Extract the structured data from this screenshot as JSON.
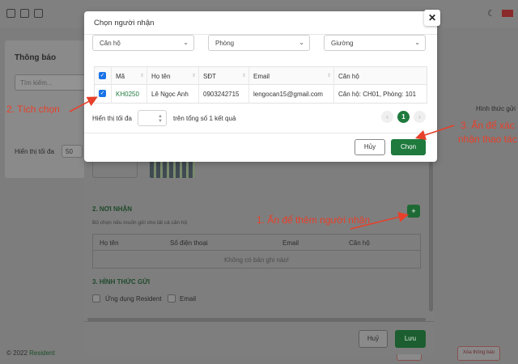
{
  "background": {
    "notifications_title": "Thông báo",
    "search_placeholder": "Tìm kiếm...",
    "show_label": "Hiển thị tối đa",
    "show_value": "50",
    "right_label": "Hình thức gửi",
    "footer_copyright": "© 2022",
    "footer_brand": "Resident",
    "footer_btn1": "Xuất...",
    "footer_btn2": "Xóa thông báo"
  },
  "form": {
    "section2_title": "2. NƠI NHẬN",
    "section2_hint": "Bỏ chọn nếu muốn gửi cho tất cả căn hộ",
    "add_button_symbol": "+",
    "table_headers": [
      "Họ tên",
      "Số điện thoại",
      "Email",
      "Căn hộ"
    ],
    "table_empty": "Không có bản ghi nào!",
    "section3_title": "3. HÌNH THỨC GỬI",
    "option_app": "Ứng dụng Resident",
    "option_email": "Email",
    "cancel_label": "Huỷ",
    "save_label": "Lưu"
  },
  "dialog": {
    "title": "Chọn người nhận",
    "close_symbol": "✕",
    "filters": [
      {
        "label": "Căn hộ"
      },
      {
        "label": "Phòng"
      },
      {
        "label": "Giường"
      }
    ],
    "table": {
      "headers": [
        "Mã",
        "Họ tên",
        "SĐT",
        "Email",
        "Căn hộ"
      ],
      "rows": [
        {
          "code": "KH0250",
          "name": "Lê Ngọc Anh",
          "phone": "0903242715",
          "email": "lengocan15@gmail.com",
          "apartment": "Căn hộ: CH01, Phòng: 101",
          "checked": true
        }
      ]
    },
    "show_label": "Hiển thị tối đa",
    "total_label": "trên tổng số 1 kết quả",
    "current_page": "1",
    "cancel_label": "Hủy",
    "select_label": "Chọn"
  },
  "annotations": {
    "step1": "1. Ấn để thêm người nhận",
    "step2": "2. Tích chọn",
    "step3_line1": "3. Ấn để xác",
    "step3_line2": "nhận thao tác",
    "color": "#e8402a"
  },
  "colors": {
    "primary_green": "#1e7a3d",
    "checkbox_blue": "#1a73e8",
    "code_link": "#1e7a3d"
  }
}
